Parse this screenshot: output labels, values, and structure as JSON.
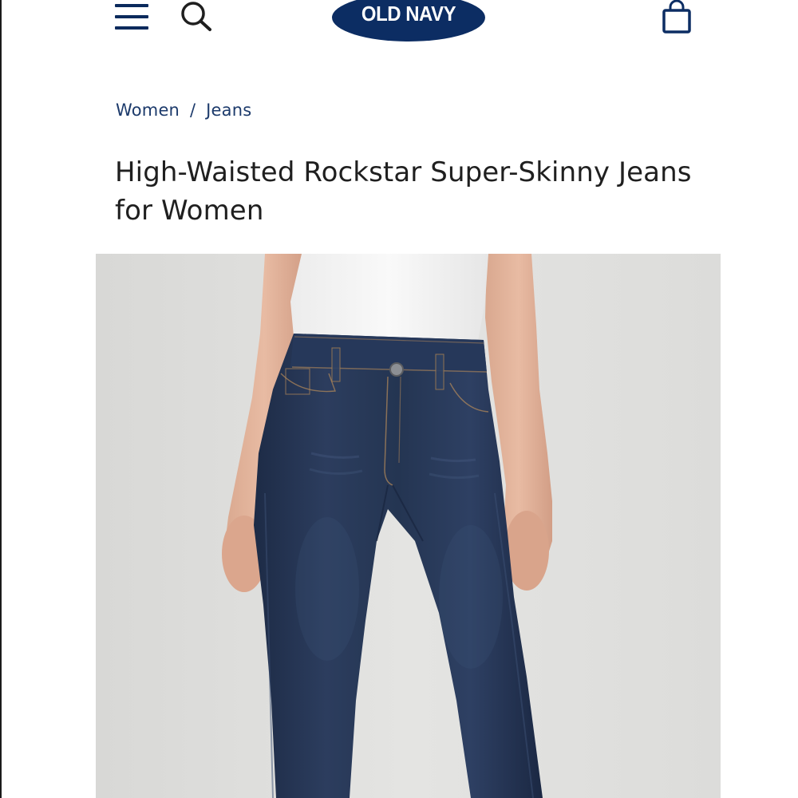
{
  "header": {
    "logo_text": "OLD NAVY",
    "menu_icon": "hamburger-menu-icon",
    "search_icon": "search-icon",
    "bag_icon": "shopping-bag-icon"
  },
  "breadcrumb": {
    "items": [
      "Women",
      "Jeans"
    ],
    "separator": "/"
  },
  "product": {
    "title": "High-Waisted Rockstar Super-Skinny Jeans for Women"
  },
  "colors": {
    "brand_navy": "#0c2d63",
    "breadcrumb": "#1c3a6b",
    "title": "#1f1f1f",
    "denim": "#22324f",
    "image_bg": "#dcdcda"
  }
}
